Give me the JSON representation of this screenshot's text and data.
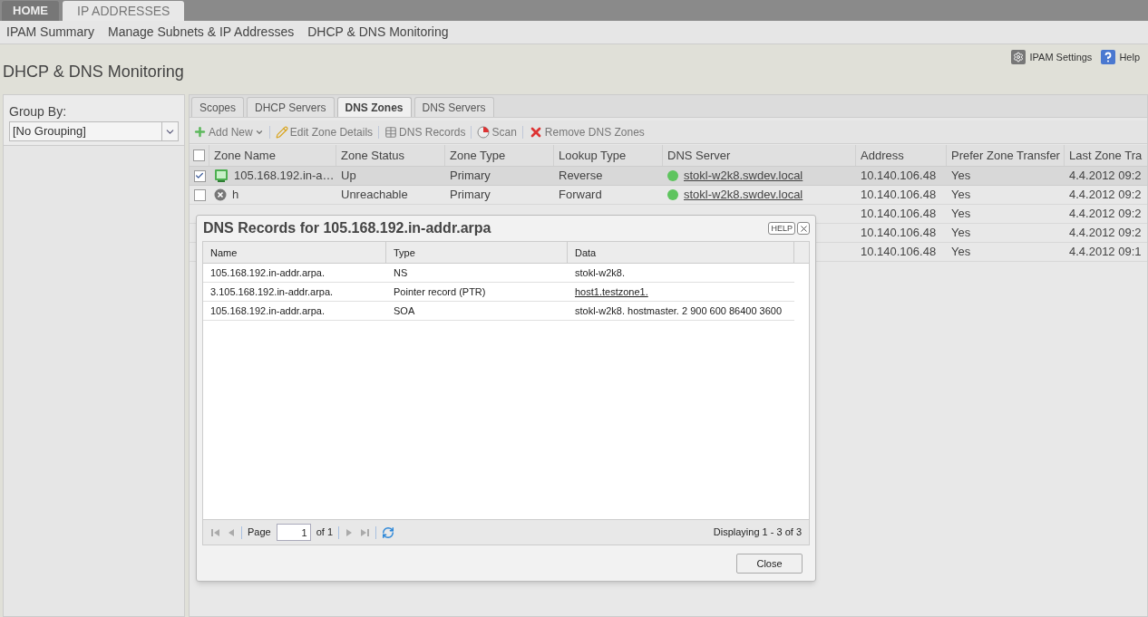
{
  "top_tabs": [
    {
      "label": "HOME",
      "selected": false
    },
    {
      "label": "IP ADDRESSES",
      "selected": true
    }
  ],
  "nav": [
    "IPAM Summary",
    "Manage Subnets & IP Addresses",
    "DHCP & DNS Monitoring"
  ],
  "page_title": "DHCP & DNS Monitoring",
  "header_links": [
    {
      "label": "IPAM Settings",
      "kind": "settings"
    },
    {
      "label": "Help",
      "kind": "help"
    }
  ],
  "group_by": {
    "label": "Group By:",
    "value": "[No Grouping]"
  },
  "zone_tabs": [
    {
      "label": "Scopes",
      "selected": false
    },
    {
      "label": "DHCP Servers",
      "selected": false
    },
    {
      "label": "DNS Zones",
      "selected": true
    },
    {
      "label": "DNS Servers",
      "selected": false
    }
  ],
  "toolbar": [
    {
      "label": "Add New",
      "kind": "add"
    },
    {
      "label": "Edit Zone Details",
      "kind": "edit"
    },
    {
      "label": "DNS Records",
      "kind": "records"
    },
    {
      "label": "Scan",
      "kind": "scan"
    },
    {
      "label": "Remove DNS Zones",
      "kind": "remove"
    }
  ],
  "grid": {
    "columns": [
      "Zone Name",
      "Zone Status",
      "Zone Type",
      "Lookup Type",
      "DNS Server",
      "Address",
      "Prefer Zone Transfer",
      "Last Zone Tra"
    ],
    "select_all": {
      "checked": false
    },
    "rows": [
      {
        "checked": true,
        "kind": "up",
        "zone_name": "105.168.192.in-a…",
        "zone_status": "Up",
        "zone_type": "Primary",
        "lookup_type": "Reverse",
        "dns_server": "stokl-w2k8.swdev.local",
        "address": "10.140.106.48",
        "prefer": "Yes",
        "last": "4.4.2012 09:2"
      },
      {
        "checked": false,
        "kind": "unreachable",
        "zone_name": "h",
        "zone_status": "Unreachable",
        "zone_type": "Primary",
        "lookup_type": "Forward",
        "dns_server": "stokl-w2k8.swdev.local",
        "address": "10.140.106.48",
        "prefer": "Yes",
        "last": "4.4.2012 09:2"
      },
      {
        "address": "10.140.106.48",
        "prefer": "Yes",
        "last": "4.4.2012 09:2"
      },
      {
        "address": "10.140.106.48",
        "prefer": "Yes",
        "last": "4.4.2012 09:2"
      },
      {
        "address": "10.140.106.48",
        "prefer": "Yes",
        "last": "4.4.2012 09:1"
      }
    ]
  },
  "dialog": {
    "title": "DNS Records for 105.168.192.in-addr.arpa",
    "help": "HELP",
    "columns": [
      "Name",
      "Type",
      "Data"
    ],
    "rows": [
      {
        "name": "105.168.192.in-addr.arpa.",
        "type": "NS",
        "data": "stokl-w2k8.",
        "link": false
      },
      {
        "name": "3.105.168.192.in-addr.arpa.",
        "type": "Pointer record (PTR)",
        "data": "host1.testzone1.",
        "link": true
      },
      {
        "name": "105.168.192.in-addr.arpa.",
        "type": "SOA",
        "data": "stokl-w2k8. hostmaster. 2 900 600 86400 3600",
        "link": false
      }
    ],
    "pager": {
      "page_label": "Page",
      "page_value": "1",
      "of_label": "of 1",
      "display": "Displaying 1 - 3 of 3"
    },
    "close": "Close"
  }
}
